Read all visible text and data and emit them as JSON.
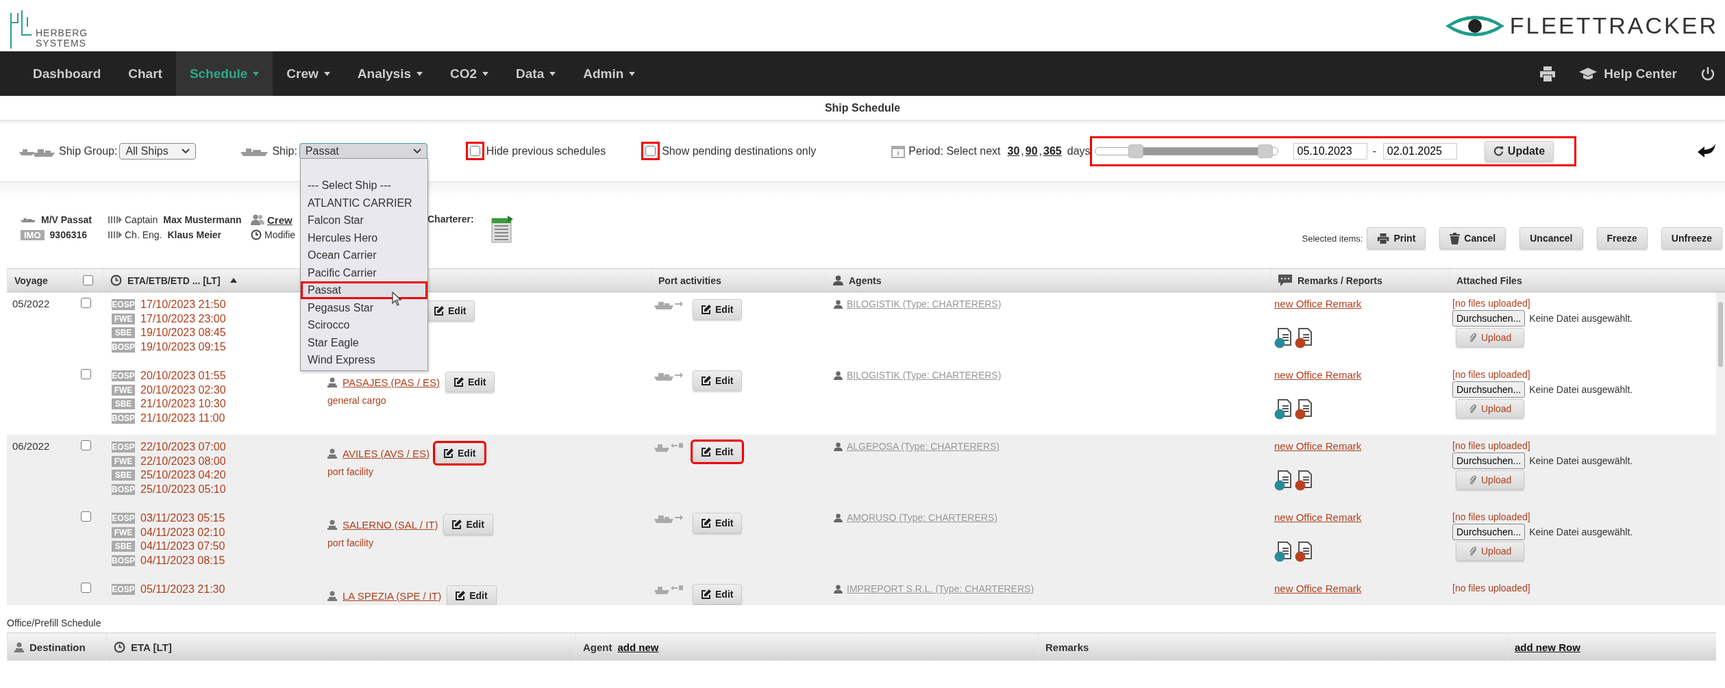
{
  "header": {
    "left_logo": [
      "HERBERG",
      "SYSTEMS"
    ],
    "right_logo": "FLEETTRACKER"
  },
  "nav": {
    "items": [
      {
        "label": "Dashboard",
        "dropdown": false,
        "selected": false
      },
      {
        "label": "Chart",
        "dropdown": false,
        "selected": false
      },
      {
        "label": "Schedule",
        "dropdown": true,
        "selected": true
      },
      {
        "label": "Crew",
        "dropdown": true,
        "selected": false
      },
      {
        "label": "Analysis",
        "dropdown": true,
        "selected": false
      },
      {
        "label": "CO2",
        "dropdown": true,
        "selected": false
      },
      {
        "label": "Data",
        "dropdown": true,
        "selected": false
      },
      {
        "label": "Admin",
        "dropdown": true,
        "selected": false
      }
    ],
    "help": "Help Center"
  },
  "title": "Ship Schedule",
  "filters": {
    "ship_group": {
      "label": "Ship Group:",
      "value": "All Ships"
    },
    "ship": {
      "label": "Ship:",
      "value": "Passat",
      "expanded": true,
      "options": [
        {
          "label": "--- Select Ship ---",
          "selected": false
        },
        {
          "label": "ATLANTIC CARRIER",
          "selected": false
        },
        {
          "label": "Falcon Star",
          "selected": false
        },
        {
          "label": "Hercules Hero",
          "selected": false
        },
        {
          "label": "Ocean Carrier",
          "selected": false
        },
        {
          "label": "Pacific Carrier",
          "selected": false
        },
        {
          "label": "Passat",
          "selected": true
        },
        {
          "label": "Pegasus Star",
          "selected": false
        },
        {
          "label": "Scirocco",
          "selected": false
        },
        {
          "label": "Star Eagle",
          "selected": false
        },
        {
          "label": "Wind Express",
          "selected": false
        }
      ]
    },
    "checks": [
      {
        "label": "Hide previous schedules",
        "checked": false,
        "highlighted": true
      },
      {
        "label": "Show pending destinations only",
        "checked": false,
        "highlighted": true
      }
    ],
    "period": {
      "label": "Period: Select next",
      "links": [
        {
          "label": "30",
          "sep": ","
        },
        {
          "label": "90",
          "sep": ","
        },
        {
          "label": "365"
        }
      ],
      "unit": "days",
      "highlighted": true,
      "thumbs": [
        {
          "level": 0.2
        },
        {
          "level": 0.97
        }
      ],
      "from": "05.10.2023",
      "to": "02.01.2025",
      "dash": "-",
      "button": "Update"
    }
  },
  "ship_info": {
    "name": "M/V Passat",
    "imo_label": "IMO",
    "imo": "9306316",
    "captain_label": "Captain",
    "captain": "Max Mustermann",
    "engineer_label": "Ch. Eng.",
    "engineer": "Klaus Meier",
    "crew": "Crew",
    "modified": "Modifie",
    "charterer_label": "Charterer:"
  },
  "actions": {
    "label": "Selected items:",
    "buttons": [
      {
        "label": "Print",
        "kind": "print"
      },
      {
        "label": "Cancel",
        "kind": "trash"
      },
      {
        "label": "Uncancel",
        "kind": "plain"
      },
      {
        "label": "Freeze",
        "kind": "plain"
      },
      {
        "label": "Unfreeze",
        "kind": "plain"
      }
    ]
  },
  "table": {
    "columns": [
      {
        "kind": "text",
        "label": "Voyage"
      },
      {
        "kind": "checkbox",
        "checked": false
      },
      {
        "kind": "clock",
        "label": "ETA/ETB/ETD ... [LT]",
        "sorted": true
      },
      {
        "kind": "blank"
      },
      {
        "kind": "text",
        "label": "Port activities"
      },
      {
        "kind": "person",
        "label": "Agents"
      },
      {
        "kind": "comment",
        "label": "Remarks / Reports"
      },
      {
        "kind": "text",
        "label": "Attached Files"
      }
    ],
    "voyages": [
      {
        "voyage": "05/2022",
        "legs": [
          {
            "checked": false,
            "times": [
              {
                "code": "EOSP",
                "time": "17/10/2023 21:50"
              },
              {
                "code": "FWE",
                "time": "17/10/2023 23:00"
              },
              {
                "code": "SBE",
                "time": "19/10/2023 08:45"
              },
              {
                "code": "BOSP",
                "time": "19/10/2023 09:15"
              }
            ],
            "edit": "Edit",
            "edit_highlighted": false,
            "kind": "out",
            "port_edit": "Edit",
            "port_edit_highlighted": false,
            "agent": "BILOGISTIK (Type: CHARTERERS)",
            "remark": "new Office Remark",
            "files": "[no files uploaded]",
            "browse": "Durchsuchen...",
            "no_file": "Keine Datei ausgewählt.",
            "upload": "Upload"
          },
          {
            "checked": false,
            "times": [
              {
                "code": "EOSP",
                "time": "20/10/2023 01:55"
              },
              {
                "code": "FWE",
                "time": "20/10/2023 02:30"
              },
              {
                "code": "SBE",
                "time": "21/10/2023 10:30"
              },
              {
                "code": "BOSP",
                "time": "21/10/2023 11:00"
              }
            ],
            "destination": "PASAJES (PAS / ES)",
            "activity": "general cargo",
            "edit": "Edit",
            "edit_highlighted": false,
            "kind": "out",
            "port_edit": "Edit",
            "port_edit_highlighted": false,
            "agent": "BILOGISTIK (Type: CHARTERERS)",
            "remark": "new Office Remark",
            "files": "[no files uploaded]",
            "browse": "Durchsuchen...",
            "no_file": "Keine Datei ausgewählt.",
            "upload": "Upload"
          }
        ]
      },
      {
        "voyage": "06/2022",
        "legs": [
          {
            "checked": false,
            "times": [
              {
                "code": "EOSP",
                "time": "22/10/2023 07:00"
              },
              {
                "code": "FWE",
                "time": "22/10/2023 08:00"
              },
              {
                "code": "SBE",
                "time": "25/10/2023 04:20"
              },
              {
                "code": "BOSP",
                "time": "25/10/2023 05:10"
              }
            ],
            "destination": "AVILES (AVS / ES)",
            "activity": "port facility",
            "edit": "Edit",
            "edit_highlighted": true,
            "kind": "exchange",
            "port_edit": "Edit",
            "port_edit_highlighted": true,
            "agent": "ALGEPOSA (Type: CHARTERERS)",
            "remark": "new Office Remark",
            "files": "[no files uploaded]",
            "browse": "Durchsuchen...",
            "no_file": "Keine Datei ausgewählt.",
            "upload": "Upload"
          },
          {
            "checked": false,
            "times": [
              {
                "code": "EOSP",
                "time": "03/11/2023 05:15"
              },
              {
                "code": "FWE",
                "time": "04/11/2023 02:10"
              },
              {
                "code": "SBE",
                "time": "04/11/2023 07:50"
              },
              {
                "code": "BOSP",
                "time": "04/11/2023 08:15"
              }
            ],
            "destination": "SALERNO (SAL / IT)",
            "activity": "port facility",
            "edit": "Edit",
            "edit_highlighted": false,
            "kind": "out",
            "port_edit": "Edit",
            "port_edit_highlighted": false,
            "agent": "AMORUSO (Type: CHARTERERS)",
            "remark": "new Office Remark",
            "files": "[no files uploaded]",
            "browse": "Durchsuchen...",
            "no_file": "Keine Datei ausgewählt.",
            "upload": "Upload"
          },
          {
            "checked": false,
            "times": [
              {
                "code": "EOSP",
                "time": "05/11/2023 21:30"
              }
            ],
            "destination": "LA SPEZIA (SPE / IT)",
            "edit": "Edit",
            "edit_highlighted": false,
            "kind": "exchange",
            "port_edit": "Edit",
            "port_edit_highlighted": false,
            "agent": "IMPREPORT S.R.L. (Type: CHARTERERS)",
            "remark": "new Office Remark",
            "files": "[no files uploaded]"
          }
        ]
      }
    ]
  },
  "prefill": {
    "title": "Office/Prefill Schedule",
    "columns": [
      {
        "kind": "pin",
        "label": "Destination"
      },
      {
        "kind": "clock",
        "label": "ETA [LT]"
      },
      {
        "kind": "text",
        "label": "Agent",
        "link": "add new"
      },
      {
        "kind": "text",
        "label": "Remarks"
      },
      {
        "kind": "text",
        "link": "add new Row"
      }
    ]
  }
}
